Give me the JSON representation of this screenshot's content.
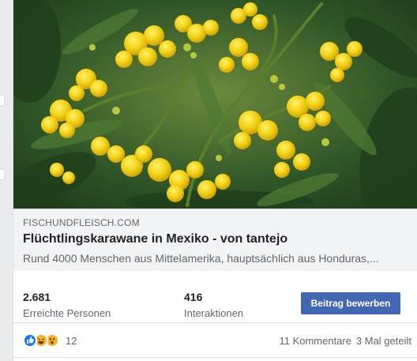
{
  "link_preview": {
    "domain": "FISCHUNDFLEISCH.COM",
    "title": "Flüchtlingskarawane in Mexiko - von tantejo",
    "description": "Rund 4000 Menschen aus Mittelamerika, hauptsächlich aus Honduras,...",
    "image_alt": "yellow flowers"
  },
  "stats": {
    "reach_value": "2.681",
    "reach_label": "Erreichte Personen",
    "engagement_value": "416",
    "engagement_label": "Interaktionen",
    "boost_label": "Beitrag bewerben"
  },
  "reactions": {
    "icons": [
      "like-icon",
      "haha-icon",
      "wow-icon"
    ],
    "count": "12",
    "comments": "11 Kommentare",
    "shares": "3 Mal geteilt"
  },
  "colors": {
    "accent": "#4267b2",
    "like": "#1877f2",
    "emoji": "#f7b125",
    "muted_text": "#606770"
  }
}
